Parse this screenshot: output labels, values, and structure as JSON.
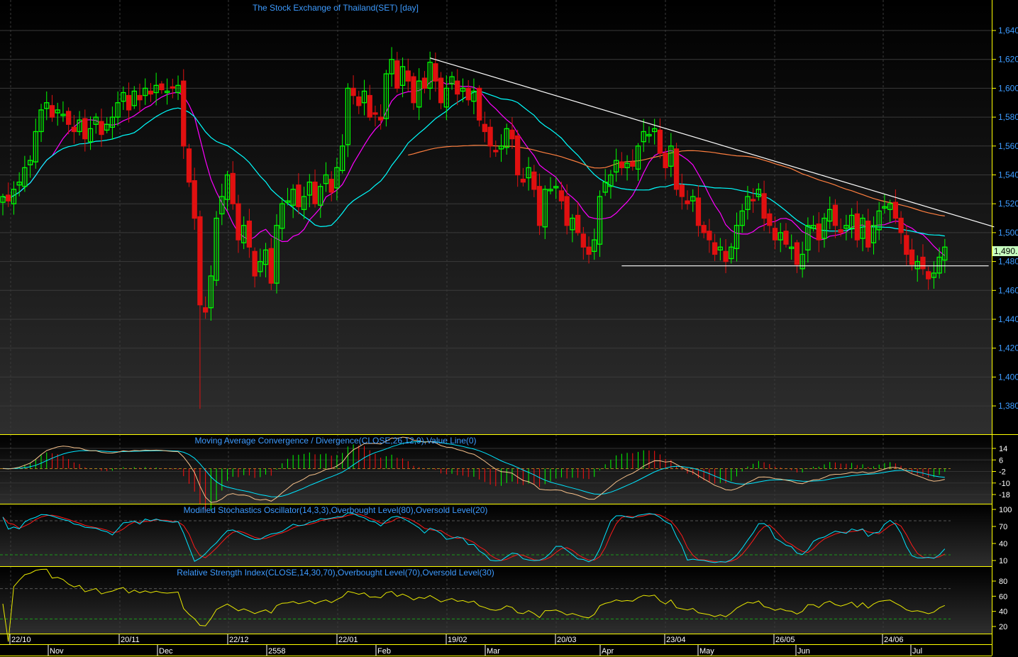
{
  "chart_data": {
    "type": "candlestick",
    "title": "The Stock Exchange of Thailand(SET) [day]",
    "ylim": [
      1360,
      1655
    ],
    "y_ticks": [
      "1,640",
      "1,620",
      "1,600",
      "1,580",
      "1,560",
      "1,540",
      "1,520",
      "1,500",
      "1,480",
      "1,460",
      "1,440",
      "1,420",
      "1,400",
      "1,380"
    ],
    "last_price_label": "1,490.",
    "closes": [
      1525,
      1522,
      1530,
      1535,
      1545,
      1550,
      1570,
      1585,
      1590,
      1580,
      1585,
      1582,
      1575,
      1570,
      1578,
      1565,
      1572,
      1580,
      1568,
      1575,
      1580,
      1590,
      1597,
      1585,
      1598,
      1592,
      1600,
      1596,
      1602,
      1599,
      1598,
      1600,
      1602,
      1560,
      1535,
      1510,
      1450,
      1445,
      1470,
      1510,
      1525,
      1540,
      1520,
      1495,
      1505,
      1490,
      1470,
      1480,
      1488,
      1465,
      1505,
      1520,
      1522,
      1530,
      1518,
      1525,
      1535,
      1520,
      1532,
      1540,
      1528,
      1545,
      1560,
      1600,
      1595,
      1588,
      1598,
      1580,
      1582,
      1578,
      1610,
      1620,
      1600,
      1615,
      1605,
      1590,
      1605,
      1600,
      1618,
      1605,
      1590,
      1600,
      1608,
      1596,
      1600,
      1592,
      1598,
      1578,
      1570,
      1560,
      1556,
      1560,
      1572,
      1565,
      1540,
      1535,
      1545,
      1530,
      1505,
      1530,
      1530,
      1532,
      1522,
      1505,
      1510,
      1500,
      1490,
      1485,
      1495,
      1525,
      1535,
      1540,
      1550,
      1545,
      1548,
      1546,
      1560,
      1570,
      1568,
      1572,
      1555,
      1545,
      1560,
      1530,
      1525,
      1520,
      1525,
      1505,
      1500,
      1495,
      1485,
      1490,
      1480,
      1490,
      1505,
      1515,
      1525,
      1522,
      1530,
      1510,
      1505,
      1495,
      1500,
      1492,
      1490,
      1478,
      1485,
      1505,
      1505,
      1495,
      1510,
      1516,
      1505,
      1500,
      1505,
      1512,
      1495,
      1510,
      1490,
      1505,
      1515,
      1518,
      1520,
      1510,
      1500,
      1485,
      1478,
      1480,
      1475,
      1468,
      1472,
      1483,
      1490
    ],
    "notable_lows": [
      {
        "index": 36,
        "low": 1378
      }
    ],
    "moving_averages": [
      {
        "name": "MA10",
        "period": 10,
        "color": "#ff00ff"
      },
      {
        "name": "MA25",
        "period": 25,
        "color": "#00ffff"
      },
      {
        "name": "MA75",
        "period": 75,
        "color": "#ff7f3f"
      }
    ],
    "trendlines": [
      {
        "name": "resistance",
        "from": [
          78,
          1621
        ],
        "to": [
          181,
          1504
        ],
        "color": "#ffffff"
      },
      {
        "name": "support",
        "from": [
          113,
          1477
        ],
        "to": [
          180,
          1477
        ],
        "color": "#ffffff"
      }
    ],
    "x_date_labels": [
      "22/10",
      "20/11",
      "22/12",
      "22/01",
      "19/02",
      "20/03",
      "23/04",
      "26/05",
      "24/06"
    ],
    "x_month_labels": [
      "Nov",
      "Dec",
      "2558",
      "Feb",
      "Mar",
      "Apr",
      "May",
      "Jun",
      "Jul"
    ],
    "indicators": {
      "macd": {
        "title": "Moving Average Convergence / Divergence(CLOSE,26,12,9),Value Line(0)",
        "ticks": [
          "14",
          "6",
          "-2",
          "-10",
          "-18"
        ],
        "ylim": [
          -24,
          20
        ]
      },
      "stoch": {
        "title": "Modified Stochastics Oscillator(14,3,3),Overbought Level(80),Oversold Level(20)",
        "ticks": [
          "100",
          "70",
          "40",
          "10"
        ],
        "overbought": 80,
        "oversold": 20
      },
      "rsi": {
        "title": "Relative Strength Index(CLOSE,14,30,70),Overbought Level(70),Oversold Level(30)",
        "ticks": [
          "80",
          "60",
          "40",
          "20"
        ],
        "overbought": 70,
        "oversold": 30
      }
    },
    "colors": {
      "up": "#00ff00",
      "down": "#e01010",
      "border": "#ffff00",
      "axis_text": "#3d9bff"
    }
  }
}
